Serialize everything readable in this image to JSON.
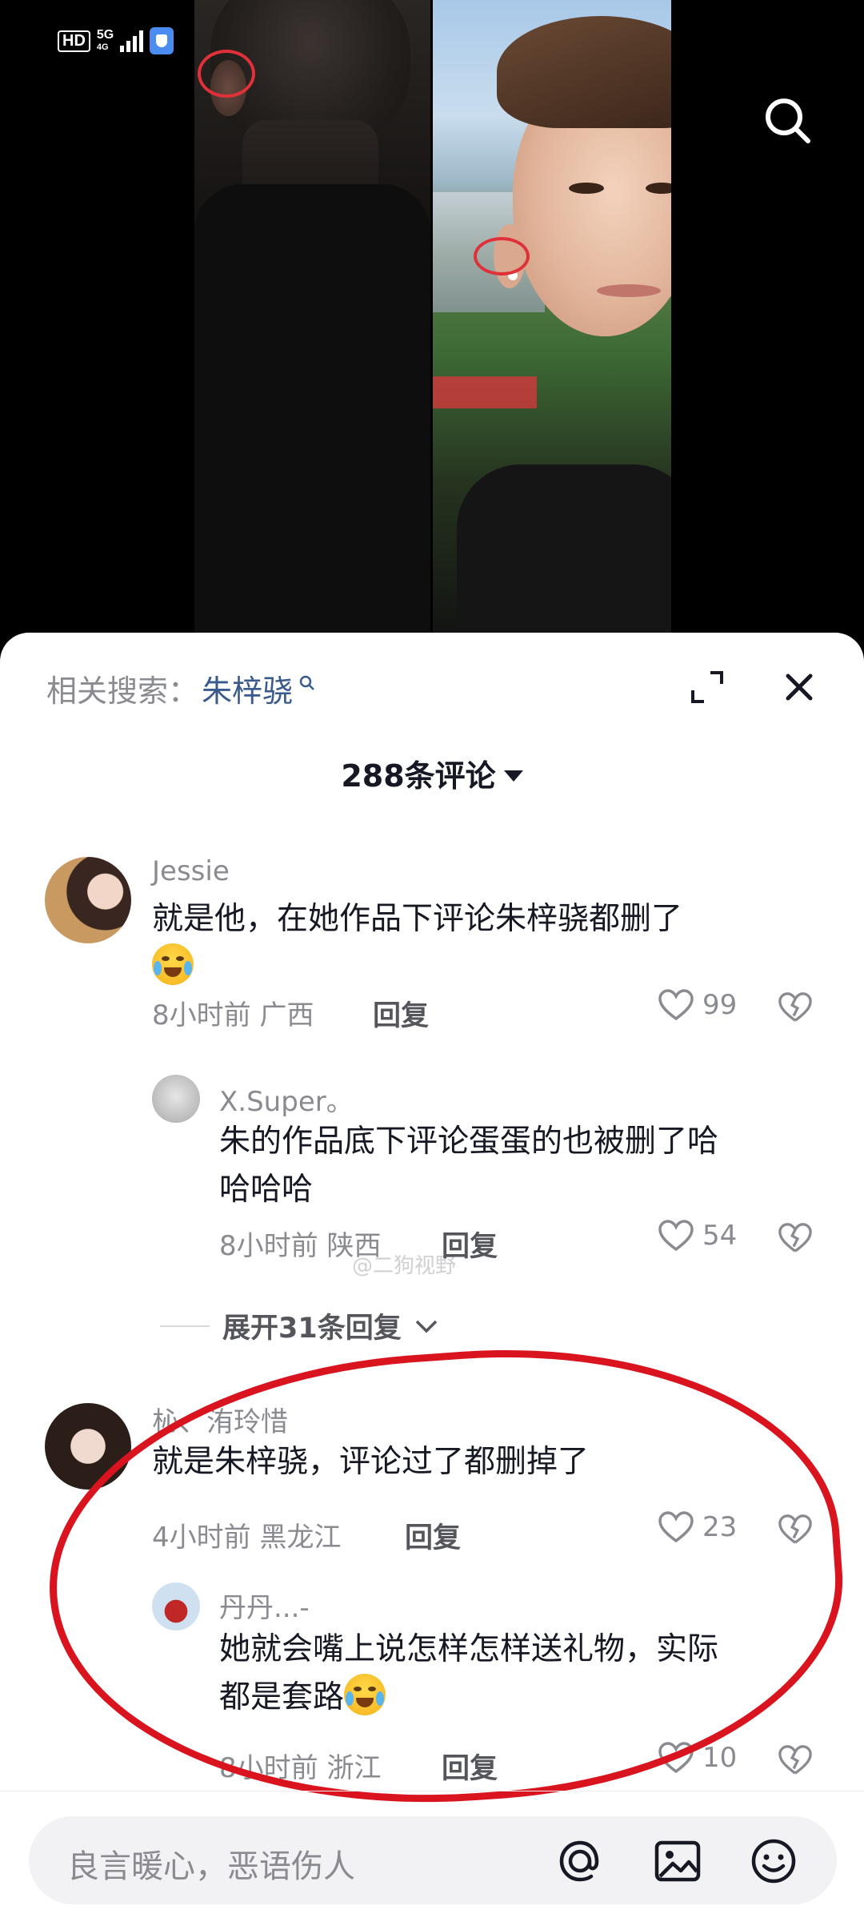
{
  "status_bar": {
    "hd": "HD",
    "network": "5G",
    "network_sub": "4G"
  },
  "sheet": {
    "related_label": "相关搜索：",
    "related_keyword": "朱梓骁",
    "comment_count": "288条评论",
    "watermark": "@二狗视野"
  },
  "comments": [
    {
      "user": "Jessie",
      "text": "就是他，在她作品下评论朱梓骁都删了",
      "emoji": "crying-laughing",
      "time": "8小时前",
      "region": "广西",
      "reply_label": "回复",
      "likes": "99",
      "replies": [
        {
          "user": "X.Super。",
          "text_line1": "朱的作品底下评论蛋蛋的也被删了哈",
          "text_line2": "哈哈哈",
          "time": "8小时前",
          "region": "陕西",
          "reply_label": "回复",
          "likes": "54"
        }
      ],
      "expand_label": "展开31条回复"
    },
    {
      "user": "杺、洧玲惜",
      "text": "就是朱梓骁，评论过了都删掉了",
      "time": "4小时前",
      "region": "黑龙江",
      "reply_label": "回复",
      "likes": "23",
      "replies": [
        {
          "user": "丹丹...-",
          "text_line1": "她就会嘴上说怎样怎样送礼物，实际",
          "text_line2": "都是套路",
          "emoji": "crying-laughing",
          "time": "8小时前",
          "region": "浙江",
          "reply_label": "回复",
          "likes": "10"
        }
      ]
    }
  ],
  "input_bar": {
    "placeholder": "良言暖心，恶语伤人"
  },
  "colors": {
    "annotation_red": "#d9141e",
    "keyword_blue": "#3a5a8c",
    "muted_gray": "#8a8b91"
  }
}
